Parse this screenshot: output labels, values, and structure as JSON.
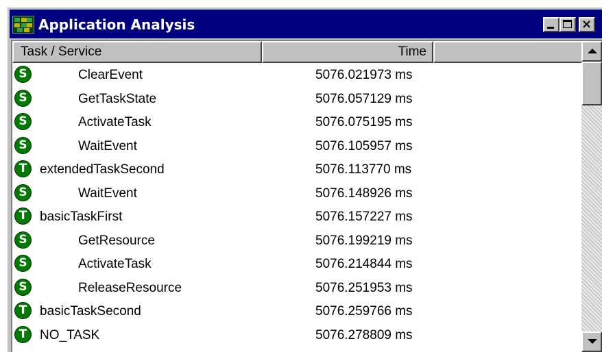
{
  "window": {
    "title": "Application Analysis",
    "controls": {
      "minimize": "",
      "maximize": "",
      "close": "×"
    }
  },
  "columns": {
    "task": "Task / Service",
    "time": "Time"
  },
  "rows": [
    {
      "kind": "S",
      "name": "ClearEvent",
      "time": "5076.021973 ms"
    },
    {
      "kind": "S",
      "name": "GetTaskState",
      "time": "5076.057129 ms"
    },
    {
      "kind": "S",
      "name": "ActivateTask",
      "time": "5076.075195 ms"
    },
    {
      "kind": "S",
      "name": "WaitEvent",
      "time": "5076.105957 ms"
    },
    {
      "kind": "T",
      "name": "extendedTaskSecond",
      "time": "5076.113770 ms"
    },
    {
      "kind": "S",
      "name": "WaitEvent",
      "time": "5076.148926 ms"
    },
    {
      "kind": "T",
      "name": "basicTaskFirst",
      "time": "5076.157227 ms"
    },
    {
      "kind": "S",
      "name": "GetResource",
      "time": "5076.199219 ms"
    },
    {
      "kind": "S",
      "name": "ActivateTask",
      "time": "5076.214844 ms"
    },
    {
      "kind": "S",
      "name": "ReleaseResource",
      "time": "5076.251953 ms"
    },
    {
      "kind": "T",
      "name": "basicTaskSecond",
      "time": "5076.259766 ms"
    },
    {
      "kind": "T",
      "name": "NO_TASK",
      "time": "5076.278809 ms"
    }
  ],
  "colors": {
    "titlebar": "#000080",
    "badge": "#007a00"
  },
  "icons": {
    "app": "application-analysis-icon",
    "service": "service-badge-icon",
    "task": "task-badge-icon"
  }
}
